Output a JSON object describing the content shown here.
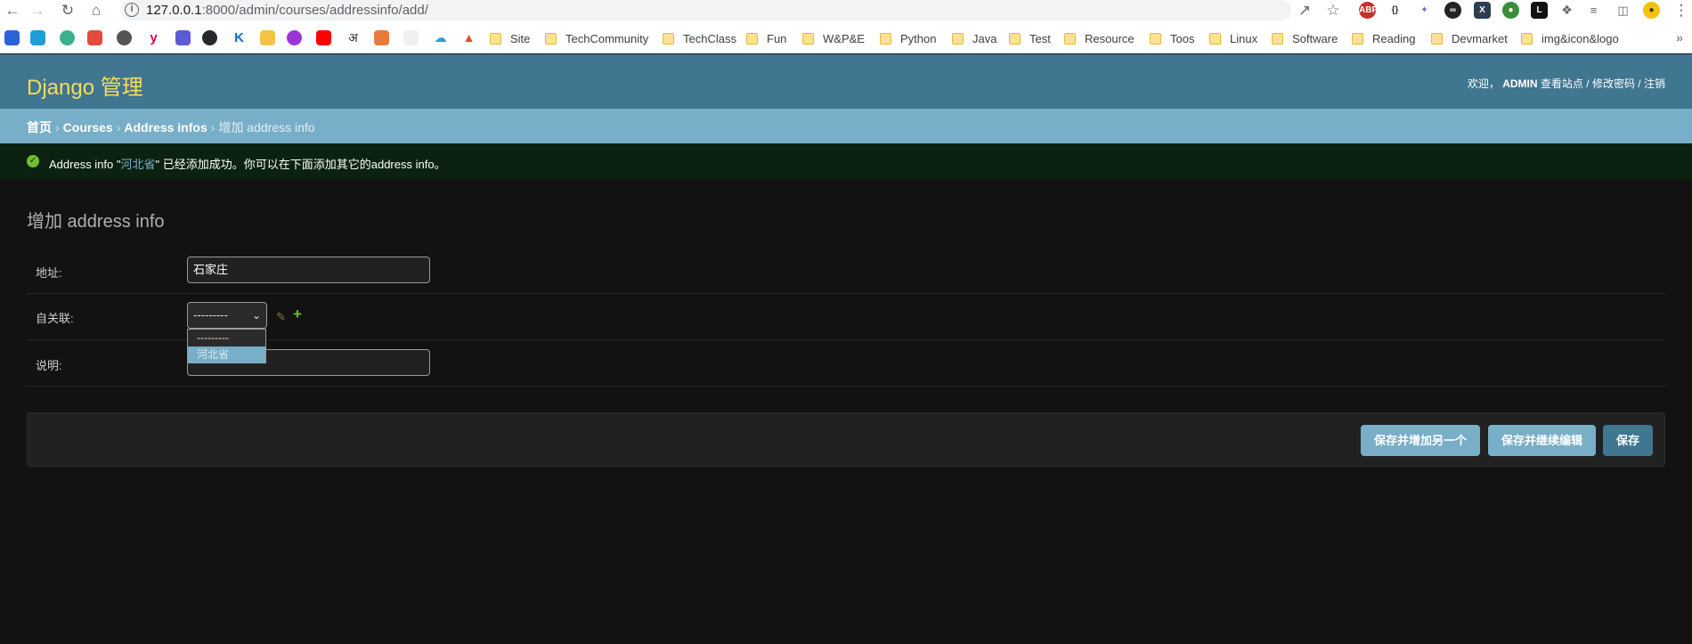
{
  "browser": {
    "url_host": "127.0.0.1",
    "url_port_path": ":8000/admin/courses/addressinfo/add/",
    "bookmarks": [
      "Site",
      "TechCommunity",
      "TechClass",
      "Fun",
      "W&P&E",
      "Python",
      "Java",
      "Test",
      "Resource",
      "Toos",
      "Linux",
      "Software",
      "Reading",
      "Devmarket",
      "img&icon&logo"
    ]
  },
  "header": {
    "brand": "Django 管理",
    "welcome": "欢迎，",
    "username": "ADMIN",
    "view_site": "查看站点",
    "change_password": "修改密码",
    "logout": "注销",
    "sep": "/"
  },
  "breadcrumbs": {
    "home": "首页",
    "app": "Courses",
    "model": "Address infos",
    "current": "增加 address info",
    "sep": "›"
  },
  "message": {
    "prefix": "Address info \"",
    "link": "河北省",
    "suffix": "\" 已经添加成功。你可以在下面添加其它的address info。"
  },
  "form": {
    "title": "增加 address info",
    "address_label": "地址:",
    "address_value": "石家庄",
    "parent_label": "自关联:",
    "parent_value": "---------",
    "parent_options": [
      "---------",
      "河北省"
    ],
    "note_label": "说明:",
    "note_value": ""
  },
  "buttons": {
    "save_add_another": "保存并增加另一个",
    "save_continue": "保存并继续编辑",
    "save": "保存"
  },
  "colors": {
    "header_bg": "#417690",
    "brand": "#f5dd5d",
    "breadcrumbs_bg": "#79aec8",
    "success_bg": "#0b2210",
    "page_bg": "#121212"
  }
}
